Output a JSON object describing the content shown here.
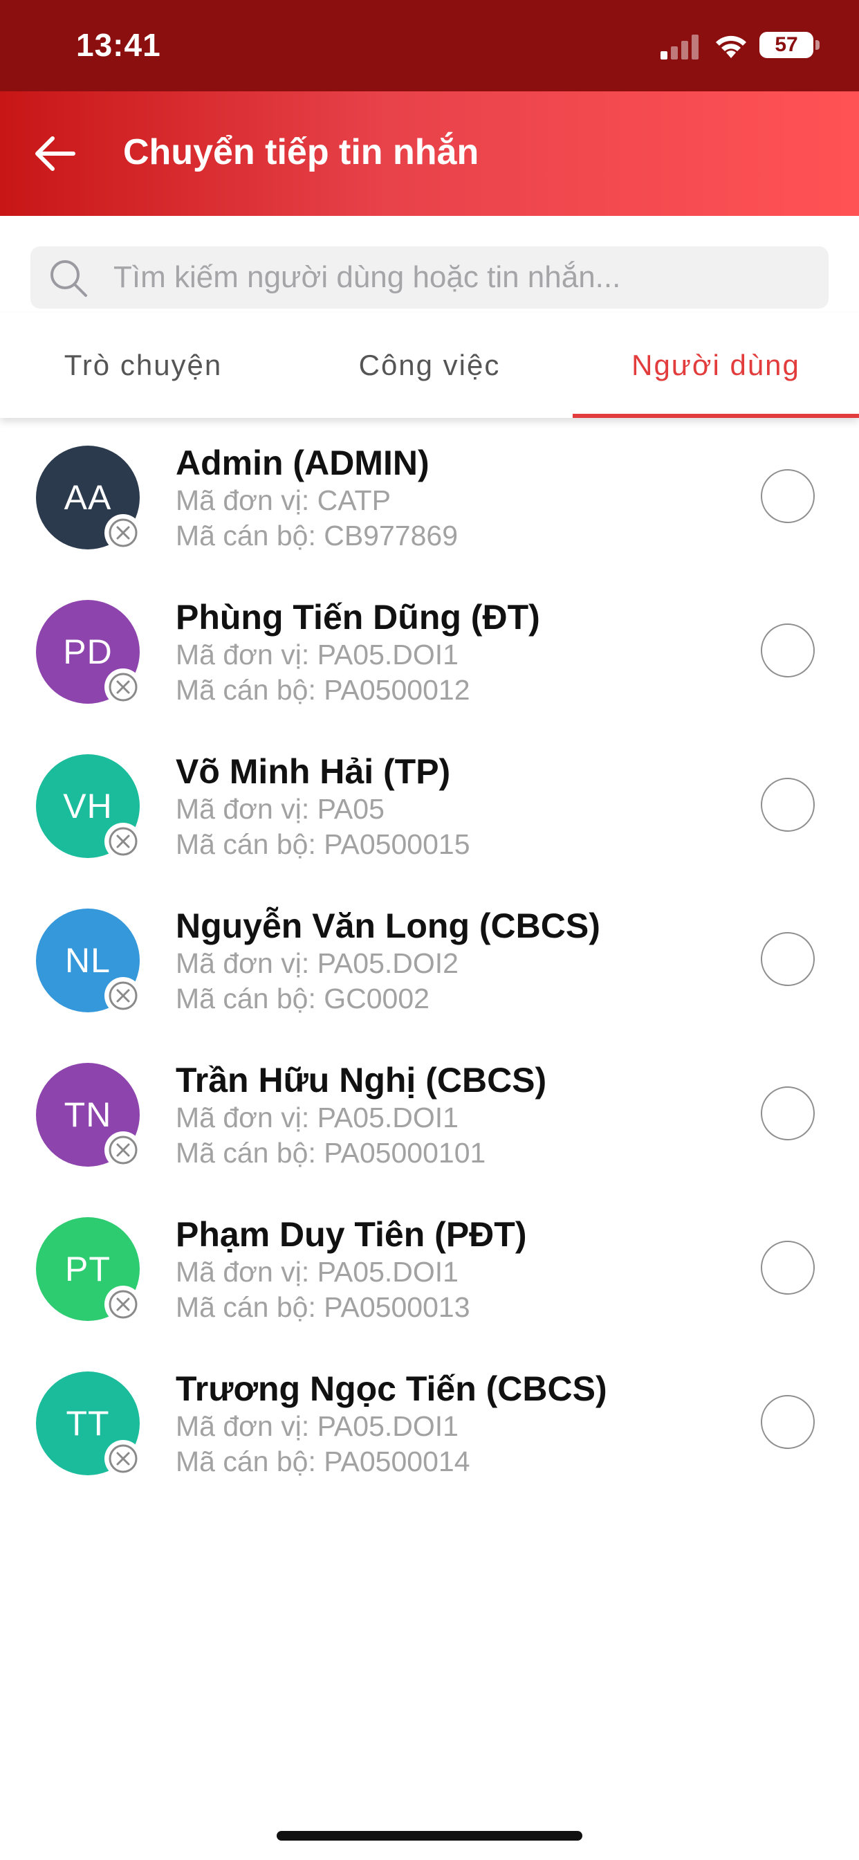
{
  "status_bar": {
    "time": "13:41",
    "battery": "57",
    "icons": [
      "cellular-signal-icon",
      "wifi-icon",
      "battery-icon"
    ]
  },
  "header": {
    "back_icon": "arrow-left-icon",
    "title": "Chuyển tiếp tin nhắn"
  },
  "search": {
    "placeholder": "Tìm kiếm người dùng hoặc tin nhắn...",
    "icon": "search-icon"
  },
  "tabs": [
    {
      "label": "Trò chuyện",
      "active": false
    },
    {
      "label": "Công việc",
      "active": false
    },
    {
      "label": "Người dùng",
      "active": true
    }
  ],
  "colors": {
    "status_bar": "#8b0f0f",
    "header_start": "#c81616",
    "header_end": "#ff5255",
    "accent": "#e23c3c"
  },
  "users": [
    {
      "initials": "AA",
      "name": "Admin (ADMIN)",
      "unit": "Mã đơn vị: CATP",
      "staff": "Mã cán bộ: CB977869",
      "avatar_color": "#2b3a4d",
      "selected": false
    },
    {
      "initials": "PD",
      "name": "Phùng Tiến Dũng (ĐT)",
      "unit": "Mã đơn vị: PA05.DOI1",
      "staff": "Mã cán bộ: PA0500012",
      "avatar_color": "#8e44ad",
      "selected": false
    },
    {
      "initials": "VH",
      "name": "Võ Minh Hải (TP)",
      "unit": "Mã đơn vị: PA05",
      "staff": "Mã cán bộ: PA0500015",
      "avatar_color": "#1abc9c",
      "selected": false
    },
    {
      "initials": "NL",
      "name": "Nguyễn Văn Long (CBCS)",
      "unit": "Mã đơn vị: PA05.DOI2",
      "staff": "Mã cán bộ: GC0002",
      "avatar_color": "#3498db",
      "selected": false
    },
    {
      "initials": "TN",
      "name": "Trần Hữu Nghị (CBCS)",
      "unit": "Mã đơn vị: PA05.DOI1",
      "staff": "Mã cán bộ: PA05000101",
      "avatar_color": "#8e44ad",
      "selected": false
    },
    {
      "initials": "PT",
      "name": "Phạm Duy Tiên (PĐT)",
      "unit": "Mã đơn vị: PA05.DOI1",
      "staff": "Mã cán bộ: PA0500013",
      "avatar_color": "#2ecc71",
      "selected": false
    },
    {
      "initials": "TT",
      "name": "Trương Ngọc Tiến (CBCS)",
      "unit": "Mã đơn vị: PA05.DOI1",
      "staff": "Mã cán bộ: PA0500014",
      "avatar_color": "#1abc9c",
      "selected": false
    }
  ]
}
